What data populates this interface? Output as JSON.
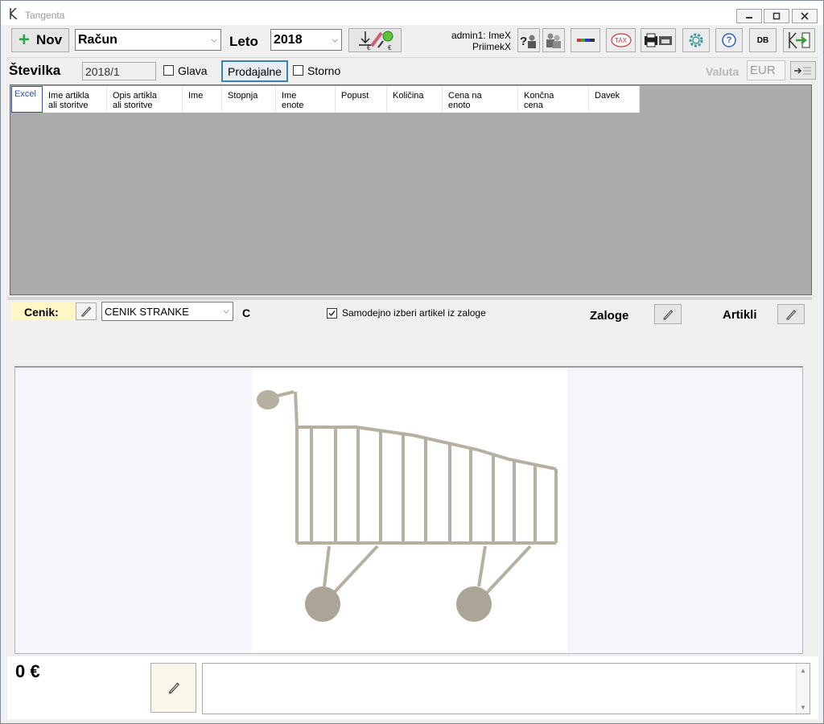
{
  "window": {
    "title": "Tangenta"
  },
  "toolbar": {
    "new_label": "Nov",
    "doc_type": "Račun",
    "year_label": "Leto",
    "year_value": "2018",
    "user_line1": "admin1: ImeX",
    "user_line2": "PriimekX",
    "db_label": "DB",
    "tax_label": "TAX",
    "help_glyph": "?"
  },
  "header_row": {
    "number_label": "Številka",
    "number_value": "2018/1",
    "glava_label": "Glava",
    "prodajalne_label": "Prodajalne",
    "storno_label": "Storno",
    "valuta_label": "Valuta",
    "valuta_value": "EUR"
  },
  "grid": {
    "columns": [
      "Excel",
      "Ime artikla\nali storitve",
      "Opis artikla\nali storitve",
      "Ime",
      "Stopnja",
      "Ime\nenote",
      "Popust",
      "Količina",
      "Cena na\nenoto",
      "Končna\ncena",
      "Davek"
    ]
  },
  "cenik": {
    "label": "Cenik:",
    "selected": "CENIK STRANKE",
    "code": "C",
    "auto_select_label": "Samodejno izberi artikel iz zaloge",
    "auto_select_checked": true,
    "zaloge_label": "Zaloge",
    "artikli_label": "Artikli"
  },
  "footer": {
    "total": "0 €"
  },
  "colors": {
    "accent_green": "#2ea44f",
    "grid_bg": "#ababab",
    "cenik_bg": "#fff8c6",
    "cart": "#b5b0a0"
  }
}
